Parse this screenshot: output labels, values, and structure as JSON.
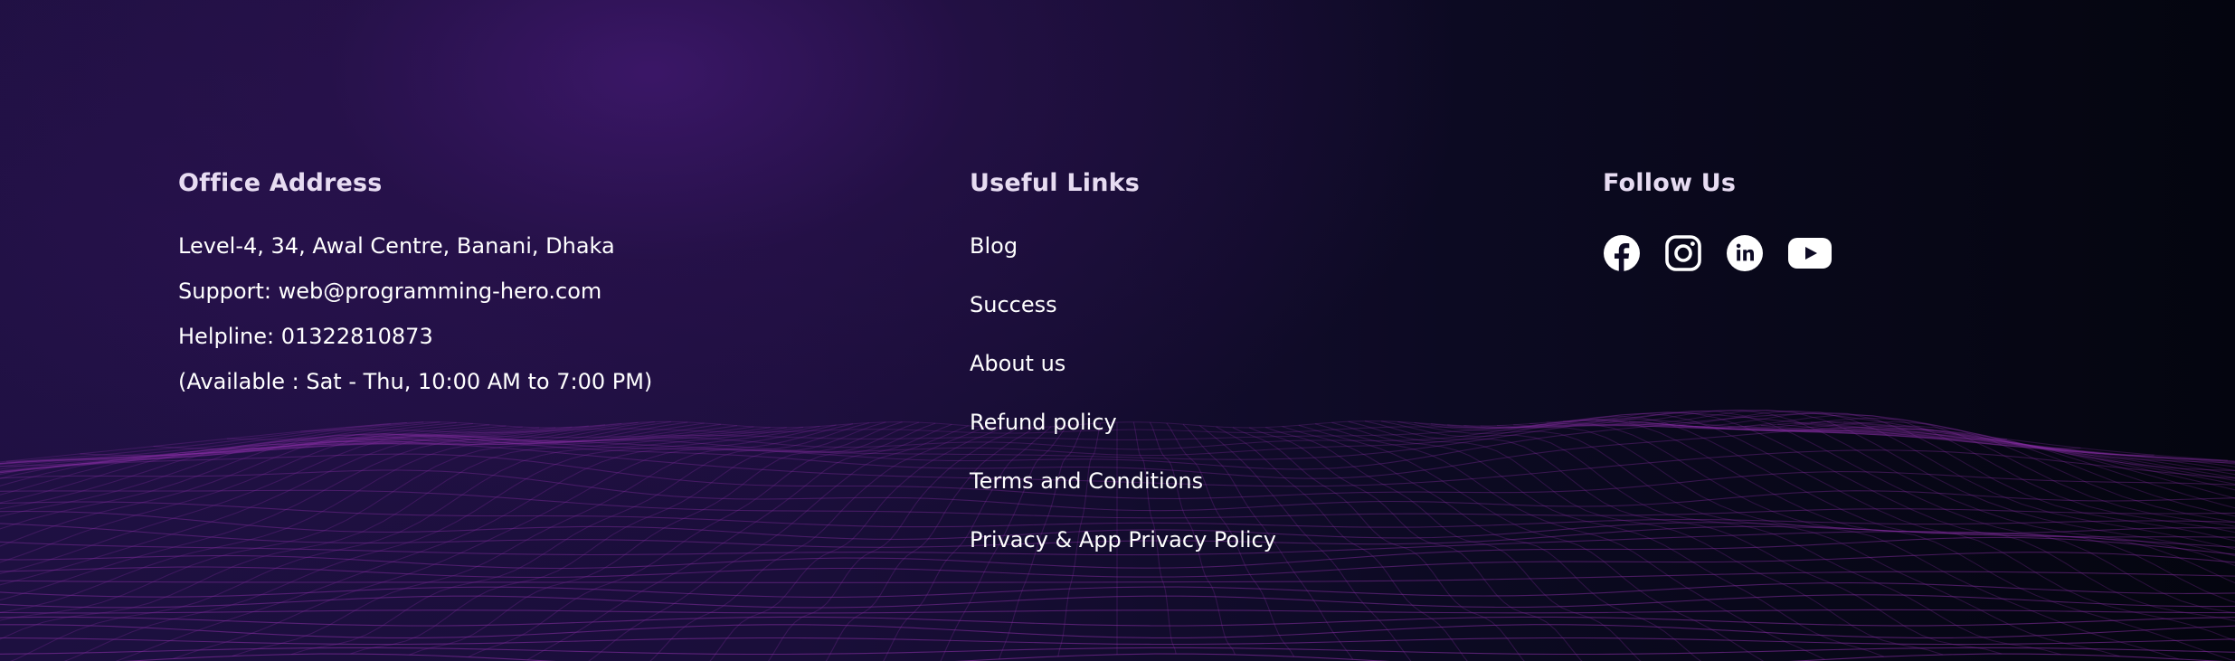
{
  "office": {
    "heading": "Office Address",
    "lines": [
      "Level-4, 34, Awal Centre, Banani, Dhaka",
      "Support: web@programming-hero.com",
      "Helpline: 01322810873",
      "(Available : Sat - Thu, 10:00 AM to 7:00 PM)"
    ]
  },
  "links": {
    "heading": "Useful Links",
    "items": [
      "Blog",
      "Success",
      "About us",
      "Refund policy",
      "Terms and Conditions",
      "Privacy & App Privacy Policy"
    ]
  },
  "follow": {
    "heading": "Follow Us",
    "icons": [
      "facebook-icon",
      "instagram-icon",
      "linkedin-icon",
      "youtube-icon"
    ]
  },
  "colors": {
    "heading": "#e7dcf2",
    "text": "#ffffff",
    "mesh": "#8a2fa6",
    "background_dark": "#04050f",
    "background_purple": "#2a1150"
  }
}
